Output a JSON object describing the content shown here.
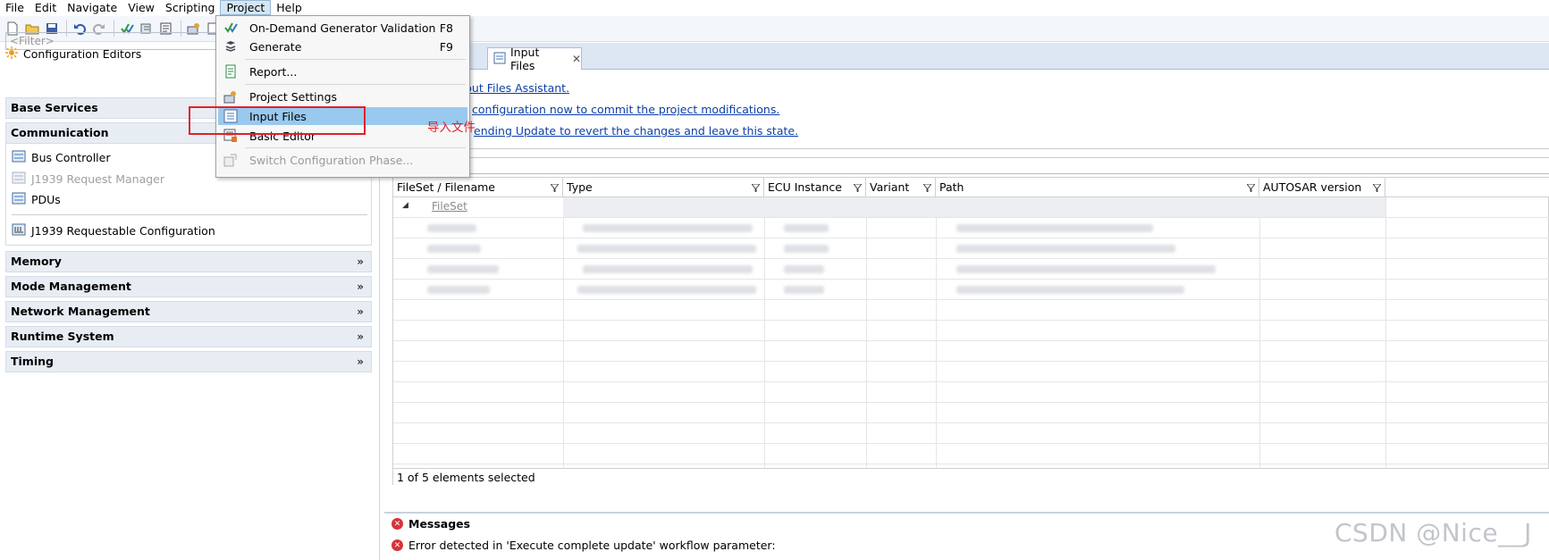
{
  "menubar": {
    "items": [
      "File",
      "Edit",
      "Navigate",
      "View",
      "Scripting",
      "Project",
      "Help"
    ],
    "active": "Project"
  },
  "toolbar": {
    "icons": [
      "new-file-icon",
      "open-folder-icon",
      "save-icon",
      "undo-icon",
      "redo-icon",
      "validate-icon",
      "generate-icon",
      "settings-icon",
      "input-files-icon",
      "editor-icon"
    ]
  },
  "left_panel": {
    "title": "Configuration Editors",
    "filter_placeholder": "<Filter>",
    "sections": {
      "base_services": "Base Services",
      "communication": "Communication",
      "memory": "Memory",
      "mode_management": "Mode Management",
      "network_management": "Network Management",
      "runtime_system": "Runtime System",
      "timing": "Timing"
    },
    "communication_items": {
      "bus_controller": "Bus Controller",
      "j1939_request_manager": "J1939 Request Manager",
      "pdus": "PDUs",
      "j1939_requestable": "J1939 Requestable Configuration"
    }
  },
  "project_menu": {
    "items": [
      {
        "label": "On-Demand Generator Validation",
        "shortcut": "F8"
      },
      {
        "label": "Generate",
        "shortcut": "F9"
      },
      {
        "label": "Report..."
      },
      {
        "label": "Project Settings"
      },
      {
        "label": "Input Files"
      },
      {
        "label": "Basic Editor"
      },
      {
        "label": "Switch Configuration Phase..."
      }
    ]
  },
  "annotation": {
    "text": "导入文件",
    "color": "#e0212b"
  },
  "editor": {
    "tab_label": "Input Files",
    "links": {
      "assistant": "put Files Assistant.",
      "commit": "configuration now to commit the project modifications.",
      "revert": "ending Update to revert the changes and leave this state."
    },
    "table": {
      "columns": [
        "FileSet / Filename",
        "Type",
        "ECU Instance",
        "Variant",
        "Path",
        "AUTOSAR version"
      ],
      "group_label": "FileSet",
      "status": "1 of 5 elements selected"
    }
  },
  "messages": {
    "title": "Messages",
    "error": "Error detected in 'Execute complete update' workflow parameter:"
  },
  "watermark": "CSDN @Nice__J"
}
